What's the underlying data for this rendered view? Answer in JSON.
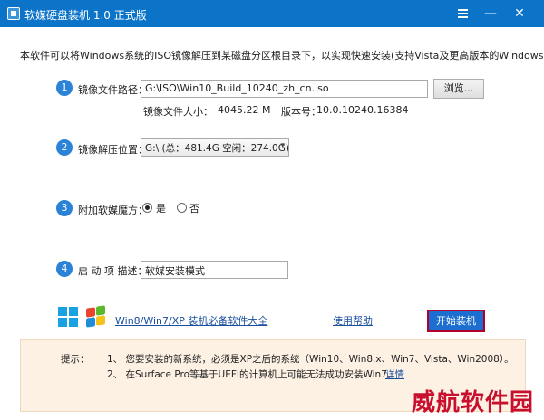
{
  "window": {
    "title": "软媒硬盘装机 1.0 正式版",
    "menu_icon": "menu-icon",
    "minimize_icon": "minimize-icon",
    "close_icon": "close-icon"
  },
  "intro": "本软件可以将Windows系统的ISO镜像解压到某磁盘分区根目录下，以实现快速安装(支持Vista及更高版本的Windows)。",
  "step1": {
    "number": "1",
    "label": "镜像文件路径：",
    "path_value": "G:\\ISO\\Win10_Build_10240_zh_cn.iso",
    "browse_label": "浏览...",
    "size_label": "镜像文件大小：",
    "size_value": "4045.22 M",
    "version_label": "版本号：",
    "version_value": "10.0.10240.16384"
  },
  "step2": {
    "number": "2",
    "label": "镜像解压位置：",
    "selected": "G:\\ (总：481.4G 空闲：274.0G)"
  },
  "step3": {
    "number": "3",
    "label": "附加软媒魔方：",
    "yes": "是",
    "no": "否",
    "checked": "yes"
  },
  "step4": {
    "number": "4",
    "label": "启 动 项 描述：",
    "value": "软媒安装模式"
  },
  "footer": {
    "software_link": "Win8/Win7/XP 装机必备软件大全",
    "help_link": "使用帮助",
    "start_button": "开始装机"
  },
  "tips": {
    "title": "提示：",
    "line1": "1、 您要安装的新系统，必须是XP之后的系统（Win10、Win8.x、Win7、Vista、Win2008）。",
    "line2": "2、 在Surface Pro等基于UEFI的计算机上可能无法成功安装Win7。",
    "details_link": "详情"
  },
  "watermark": "威航软件园",
  "colors": {
    "titlebar": "#0b74c9",
    "accent": "#2a83d6",
    "start_button": "#1c6fd1",
    "start_border": "#b3002a",
    "tips_bg": "#fdf1e4",
    "watermark": "#c8102e"
  }
}
